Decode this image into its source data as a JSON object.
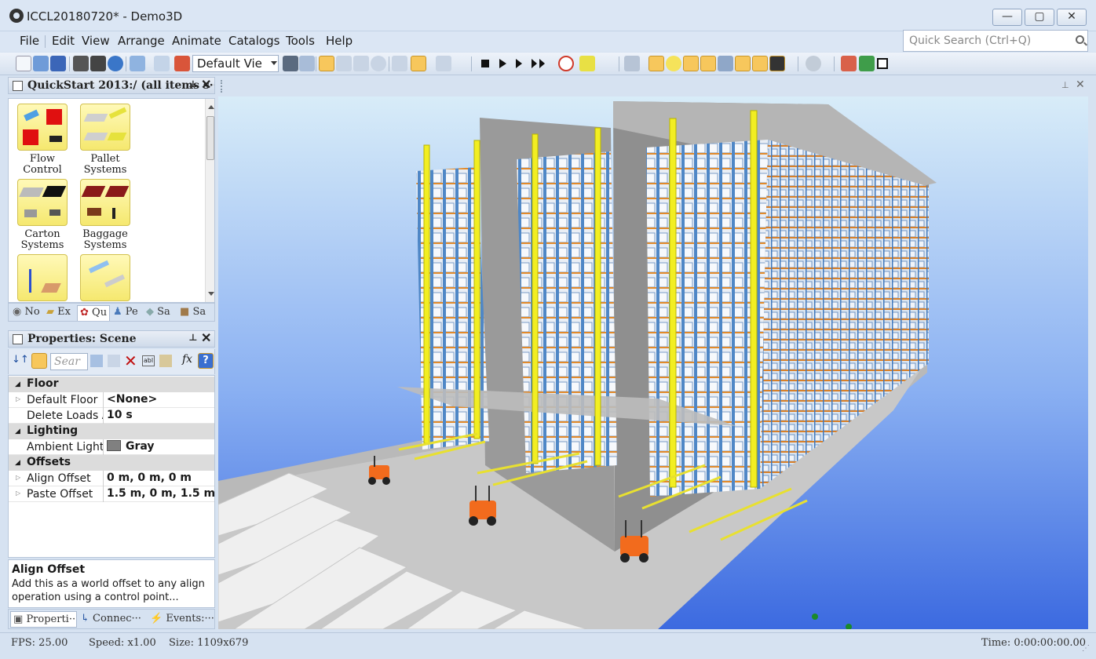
{
  "window": {
    "title": "ICCL20180720* - Demo3D",
    "minimize_icon": "minimize-icon",
    "maximize_icon": "maximize-icon",
    "close_icon": "close-icon"
  },
  "menu": {
    "items": [
      "File",
      "Edit",
      "View",
      "Arrange",
      "Animate",
      "Catalogs",
      "Tools",
      "Help"
    ]
  },
  "quick_search": {
    "placeholder": "Quick Search (Ctrl+Q)",
    "icon": "search-icon"
  },
  "toolbar": {
    "view_select": "Default Vie"
  },
  "catalog_panel": {
    "title": "QuickStart 2013:/ (all items s···",
    "pin_icon": "pin-icon",
    "close_icon": "close-icon",
    "items": [
      {
        "label": "Flow Control"
      },
      {
        "label": "Pallet Systems"
      },
      {
        "label": "Carton Systems"
      },
      {
        "label": "Baggage Systems"
      },
      {
        "label": ""
      },
      {
        "label": ""
      }
    ],
    "tabs": [
      "No",
      "Ex",
      "Qu",
      "Pe",
      "Sa",
      "Sa"
    ]
  },
  "properties_panel": {
    "title": "Properties: Scene",
    "search_placeholder": "Sear",
    "categories": {
      "floor": "Floor",
      "lighting": "Lighting",
      "offsets": "Offsets"
    },
    "rows": {
      "default_floor": {
        "name": "Default Floor",
        "value": "<None>"
      },
      "delete_loads": {
        "name": "Delete Loads A",
        "value": "10 s"
      },
      "ambient_light": {
        "name": "Ambient Light",
        "value": "Gray",
        "color": "#808080"
      },
      "align_offset": {
        "name": "Align Offset",
        "value": "0 m, 0 m, 0 m"
      },
      "paste_offset": {
        "name": "Paste Offset",
        "value": "1.5 m, 0 m, 1.5 m"
      }
    },
    "description": {
      "title": "Align Offset",
      "text": "Add this as a world offset to any align operation using a control point..."
    },
    "tabs": [
      "Properti···",
      "Connec···",
      "Events:···"
    ]
  },
  "status": {
    "fps": "FPS: 25.00",
    "speed": "Speed: x1.00",
    "size": "Size: 1109x679",
    "time": "Time: 0:00:00:00.00"
  },
  "colors": {
    "sky_top": "#d8ecf8",
    "sky_bottom": "#3c6ae0",
    "rack_blue": "#4f87c6",
    "crane_yellow": "#f2ee22",
    "forklift_orange": "#f26b1d"
  }
}
